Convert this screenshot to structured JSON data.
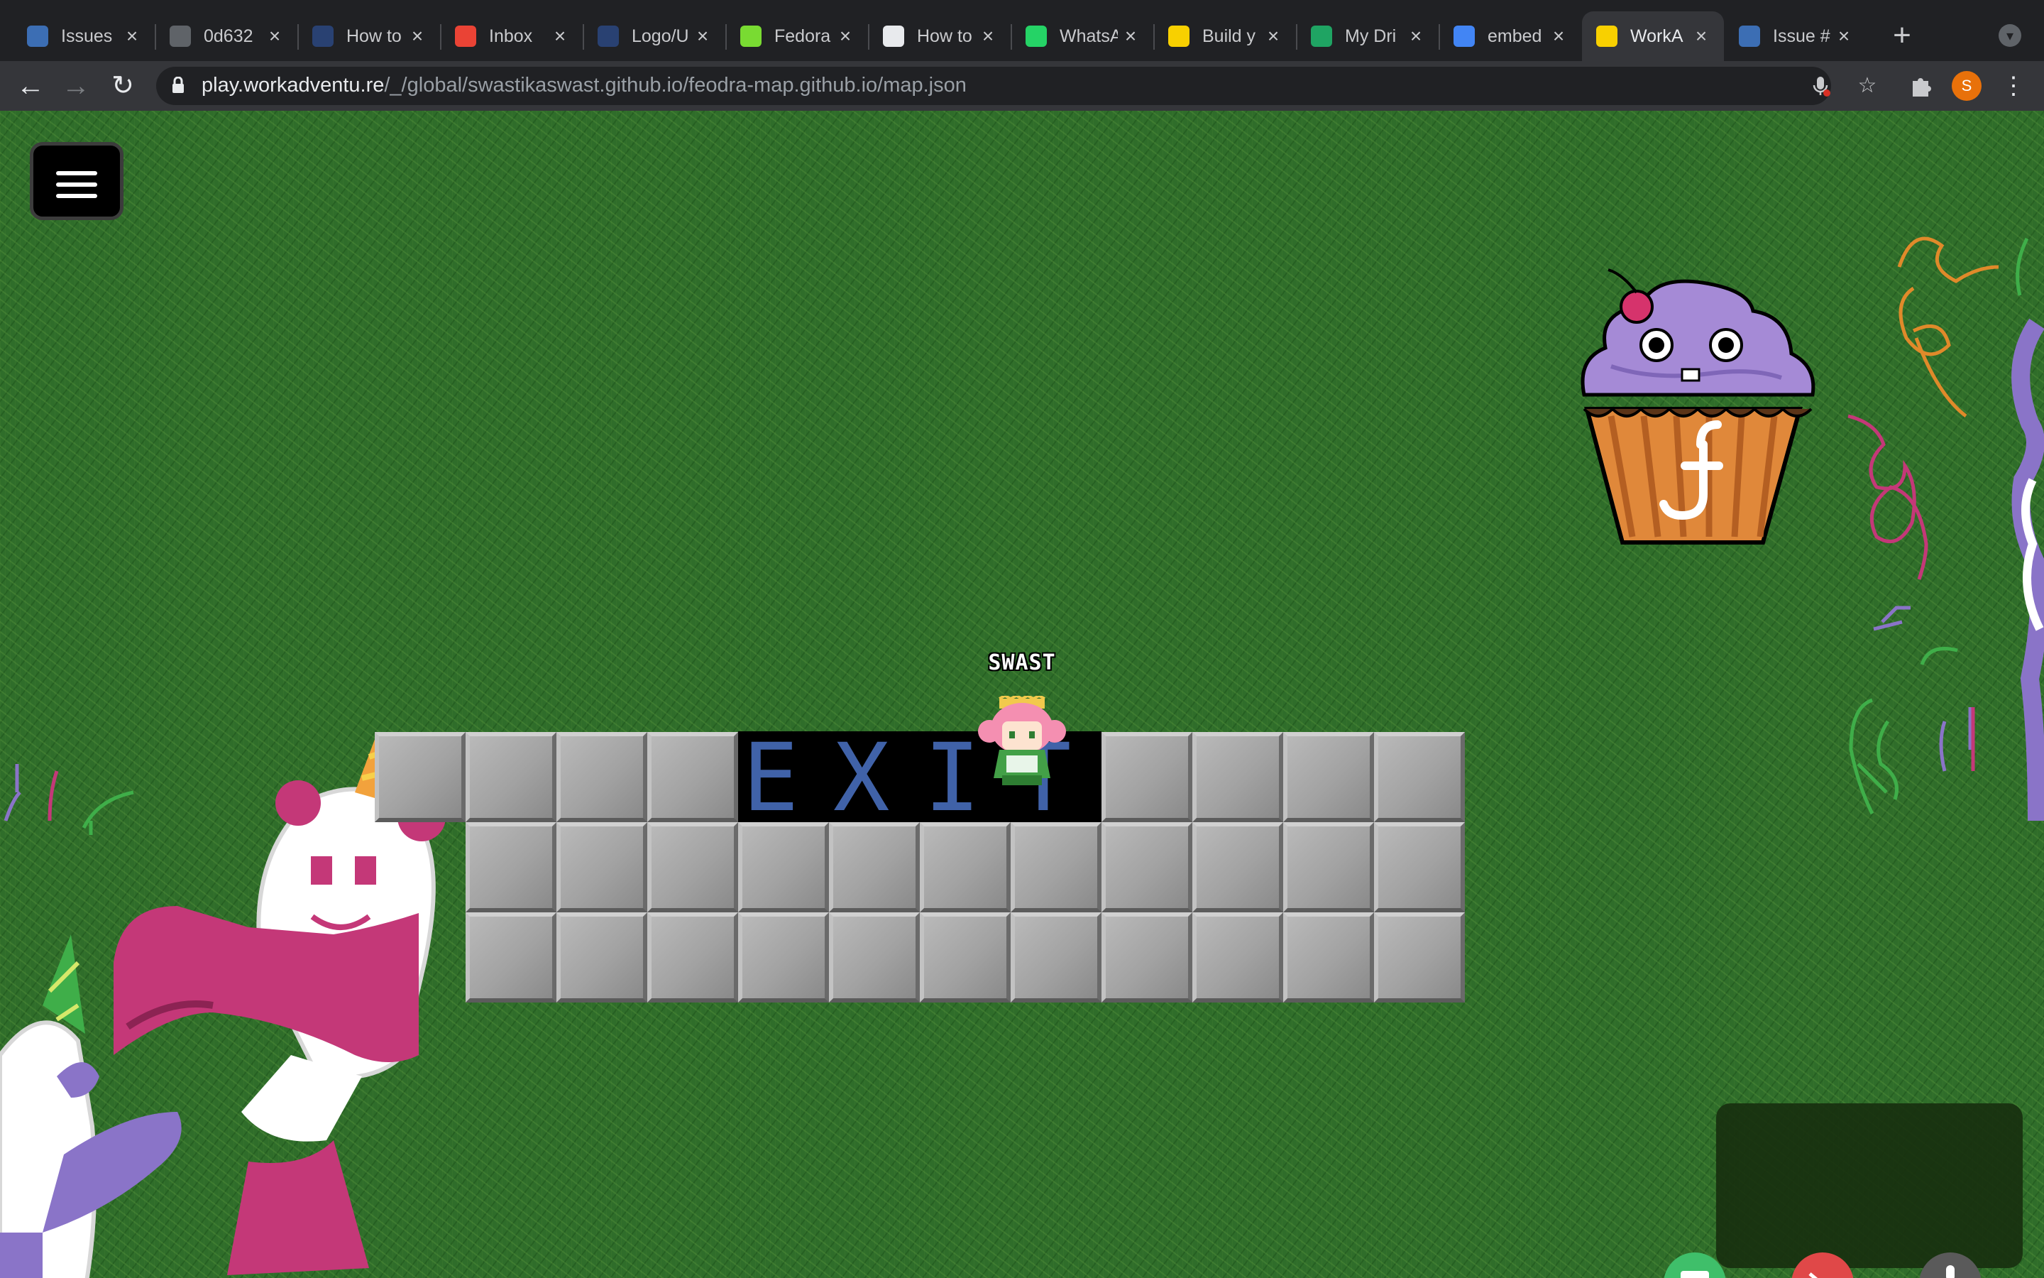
{
  "tabs": [
    {
      "label": "Issues",
      "icon": "fedora-bug-icon",
      "color": "#3c6eb4"
    },
    {
      "label": "0d632",
      "icon": "globe-icon",
      "color": "#5f6368"
    },
    {
      "label": "How to",
      "icon": "fedora-logo-icon",
      "color": "#294172"
    },
    {
      "label": "Inbox",
      "icon": "gmail-icon",
      "color": "#ea4335"
    },
    {
      "label": "Logo/U",
      "icon": "fedora-logo-icon",
      "color": "#294172"
    },
    {
      "label": "Fedora",
      "icon": "fedora-frog-icon",
      "color": "#79db32"
    },
    {
      "label": "How to",
      "icon": "github-icon",
      "color": "#e8eaed"
    },
    {
      "label": "WhatsA",
      "icon": "whatsapp-icon",
      "color": "#25d366"
    },
    {
      "label": "Build y",
      "icon": "workadventure-icon",
      "color": "#f8d000"
    },
    {
      "label": "My Dri",
      "icon": "google-drive-icon",
      "color": "#1fa463"
    },
    {
      "label": "embed",
      "icon": "google-icon",
      "color": "#4285f4"
    },
    {
      "label": "WorkA",
      "icon": "workadventure-icon",
      "color": "#f8d000",
      "active": true
    },
    {
      "label": "Issue #",
      "icon": "fedora-bug-icon",
      "color": "#3c6eb4"
    }
  ],
  "toolbar": {
    "url_host": "play.workadventu.re",
    "url_path": "/_/global/swastikaswast.github.io/feodra-map.github.io/map.json",
    "profile_initial": "S"
  },
  "game": {
    "player_name": "SWAST",
    "exit_sign": [
      "E",
      "X",
      "I",
      "T"
    ]
  }
}
